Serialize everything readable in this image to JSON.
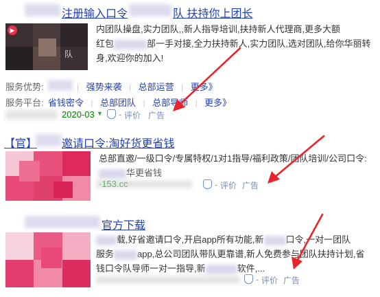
{
  "results": [
    {
      "title": "注册输入口令",
      "title_suffix": "队  扶持你上团长",
      "thumb_badge": "队",
      "description_lines": [
        "内团队操盘,实力团队,,新人指导培训,扶持新人代理商,更多大额",
        "红包",
        "部一手对接,全力扶持新人,实力团队,选对团队,给你华丽转",
        "身,欢迎你的加入!"
      ],
      "advantages_label": "服务优势:",
      "advantages": [
        "强势来袭",
        "总部运营",
        "更多》"
      ],
      "platform_label": "服务平台:",
      "platforms": [
        "省钱密令",
        "总部团队",
        "总部导师",
        "更多》"
      ],
      "date": "2020-03",
      "rate_label": "评价",
      "ad_label": "广告"
    },
    {
      "title_prefix": "【官】",
      "title": "邀请口令:淘好货更省钱",
      "description_lines": [
        "总部直邀/一级口令/专属特权/1对1指导/福利政策/团队培训/公司口令:",
        "华更省钱"
      ],
      "url_fragment": "·153.cc",
      "rate_label": "评价",
      "ad_label": "广告"
    },
    {
      "title": "官方下载",
      "description_lines": [
        "载,好省邀请口令,开启app所有功能,新",
        "口令,一对一团队",
        "服务",
        "app,总公司团队带队更靠谱,新人免费参与团队扶持计划,省",
        "钱口令队导师一对一指导,新",
        "软件,..."
      ],
      "rate_label": "评价",
      "ad_label": "广告"
    }
  ],
  "colors": {
    "link": "#2440b3",
    "green": "#008000",
    "arrow": "#e8242a"
  },
  "icons": [
    "video-play-icon",
    "dropdown-triangle-icon",
    "verified-shield-icon"
  ]
}
